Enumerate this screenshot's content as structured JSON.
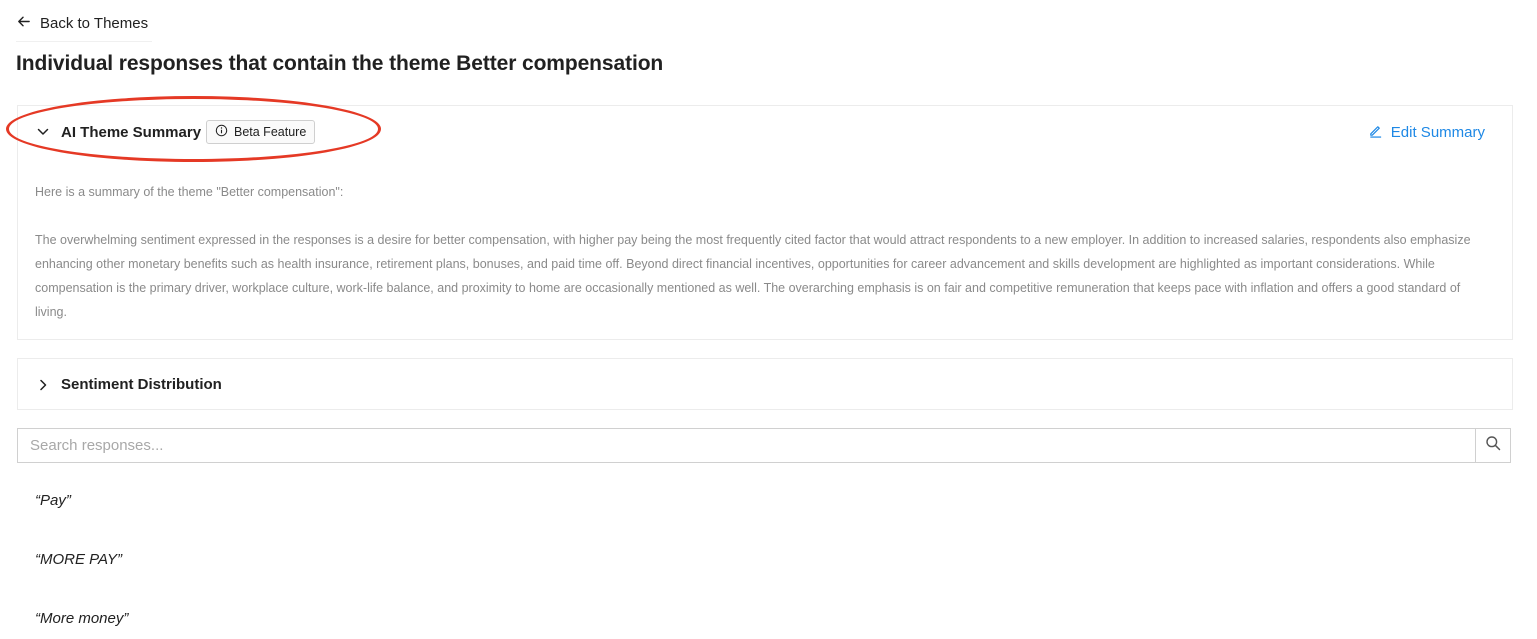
{
  "nav": {
    "back_label": "Back to Themes"
  },
  "page_title": "Individual responses that contain the theme Better compensation",
  "summary_panel": {
    "title": "AI Theme Summary",
    "badge": "Beta Feature",
    "edit_label": "Edit Summary",
    "intro": "Here is a summary of the theme \"Better compensation\":",
    "body": "The overwhelming sentiment expressed in the responses is a desire for better compensation, with higher pay being the most frequently cited factor that would attract respondents to a new employer. In addition to increased salaries, respondents also emphasize enhancing other monetary benefits such as health insurance, retirement plans, bonuses, and paid time off. Beyond direct financial incentives, opportunities for career advancement and skills development are highlighted as important considerations. While compensation is the primary driver, workplace culture, work-life balance, and proximity to home are occasionally mentioned as well. The overarching emphasis is on fair and competitive remuneration that keeps pace with inflation and offers a good standard of living."
  },
  "sentiment_panel": {
    "title": "Sentiment Distribution"
  },
  "search": {
    "placeholder": "Search responses..."
  },
  "responses": [
    "“Pay”",
    "“MORE PAY”",
    "“More money”"
  ],
  "colors": {
    "accent": "#1e88e5",
    "annotation": "#e53925"
  }
}
